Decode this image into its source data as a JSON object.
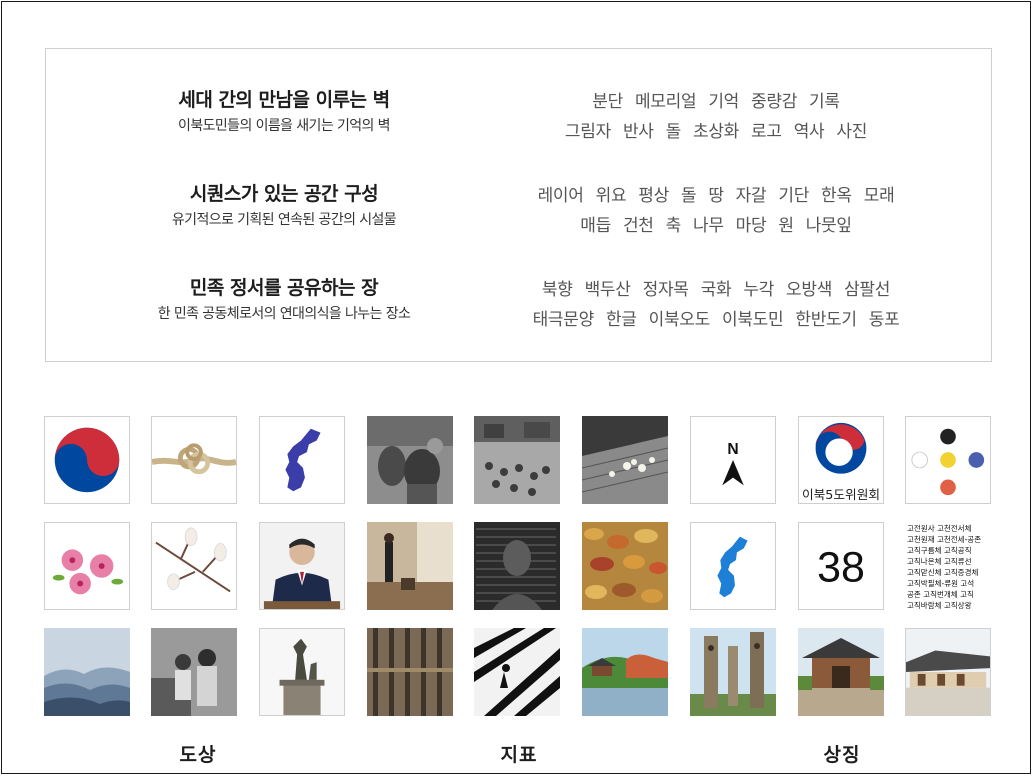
{
  "concepts": [
    {
      "title": "세대 간의 만남을 이루는 벽",
      "subtitle": "이북도민들의 이름을 새기는 기억의 벽",
      "keywords": [
        [
          "분단",
          "메모리얼",
          "기억",
          "중량감",
          "기록"
        ],
        [
          "그림자",
          "반사",
          "돌",
          "초상화",
          "로고",
          "역사",
          "사진"
        ]
      ]
    },
    {
      "title": "시퀀스가 있는 공간 구성",
      "subtitle": "유기적으로 기획된 연속된 공간의 시설물",
      "keywords": [
        [
          "레이어",
          "위요",
          "평상",
          "돌",
          "땅",
          "자갈",
          "기단",
          "한옥",
          "모래"
        ],
        [
          "매듭",
          "건천",
          "축",
          "나무",
          "마당",
          "원",
          "나뭇잎"
        ]
      ]
    },
    {
      "title": "민족 정서를 공유하는 장",
      "subtitle": "한 민족 공동체로서의 연대의식을 나누는 장소",
      "keywords": [
        [
          "북향",
          "백두산",
          "정자목",
          "국화",
          "누각",
          "오방색",
          "삼팔선"
        ],
        [
          "태극문양",
          "한글",
          "이북오도",
          "이북도민",
          "한반도기",
          "동포"
        ]
      ]
    }
  ],
  "tiles": {
    "north_label": "N",
    "logo_text": "이북5도위원회",
    "number_38": "38",
    "hanja_lines": [
      "고전원사 고천전서체",
      "고천원재 고천전세-공존",
      "고직구름체 고직공직",
      "고직나온체 고직류선",
      "고직맏신체 고직증경체",
      "고직박필체-류원 고석",
      "공존 고직번개체 고직",
      "고직바람체 고직상왕"
    ]
  },
  "captions": [
    "도상",
    "지표",
    "상징"
  ],
  "colors": {
    "taegeuk_red": "#cd2e3a",
    "taegeuk_blue": "#0047a0",
    "korea_map_purple": "#3b3ea8",
    "korea_map_blue": "#1e7fd6",
    "obang_black": "#222222",
    "obang_yellow": "#f2d230",
    "obang_blue": "#4a5fb0",
    "obang_red": "#e06045",
    "obang_white": "#ffffff"
  }
}
